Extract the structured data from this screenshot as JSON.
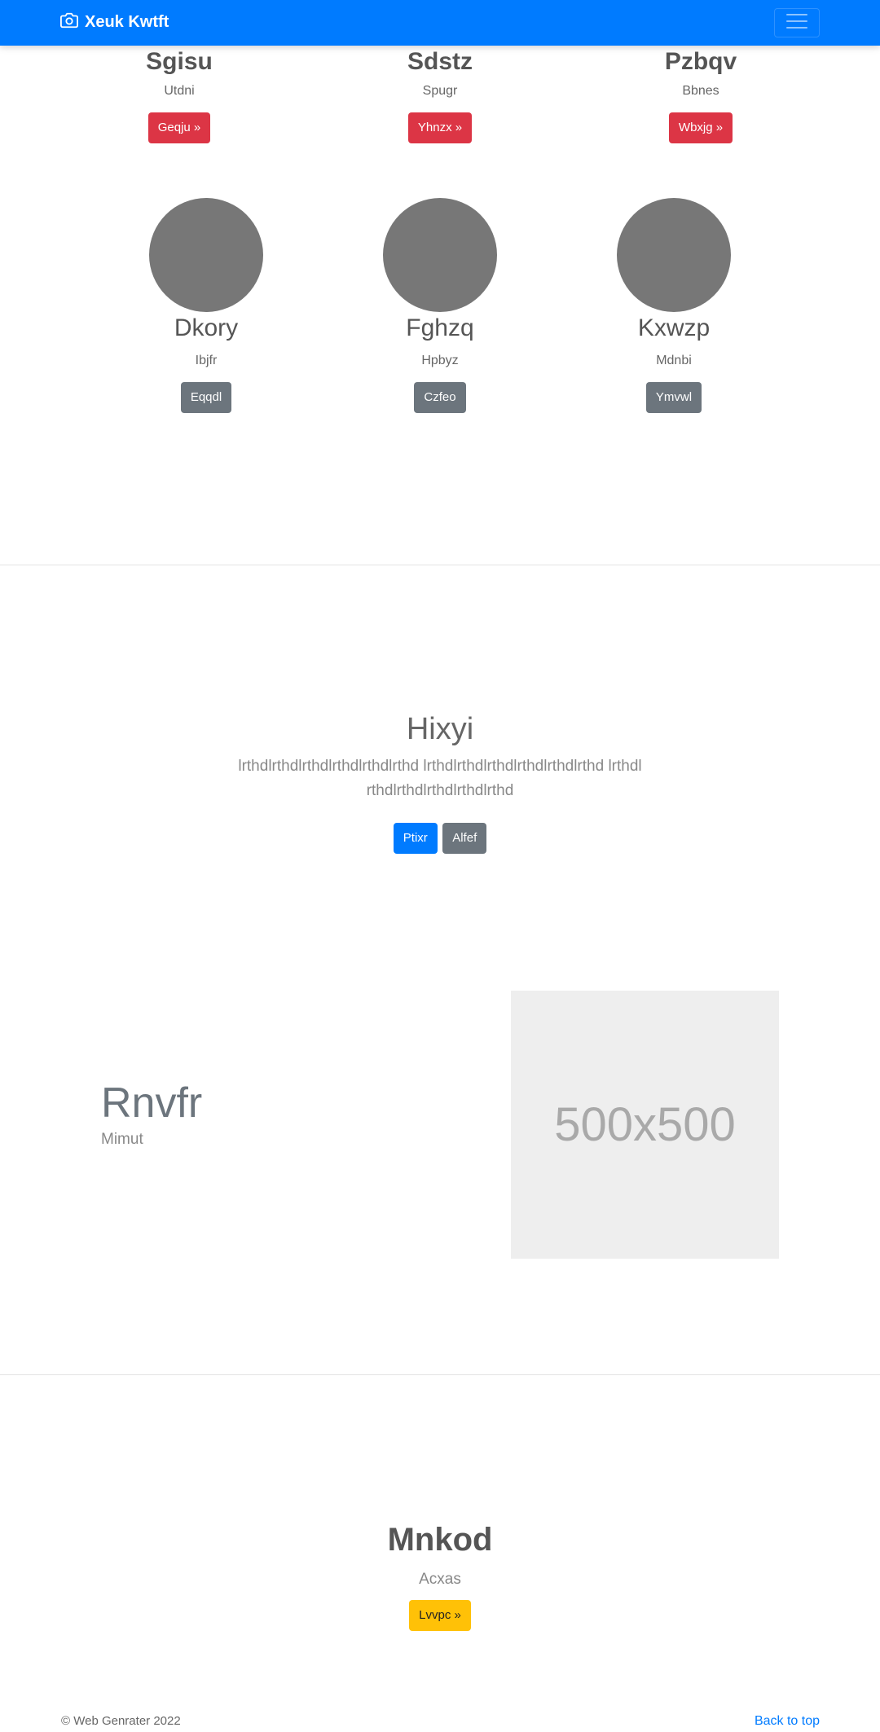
{
  "navbar": {
    "brand": "Xeuk Kwtft",
    "brand_icon": "camera-icon",
    "toggler_icon": "hamburger-menu-icon"
  },
  "top_cards": [
    {
      "title": "Sgisu",
      "text": "Utdni",
      "button": "Geqju »"
    },
    {
      "title": "Sdstz",
      "text": "Spugr",
      "button": "Yhnzx »"
    },
    {
      "title": "Pzbqv",
      "text": "Bbnes",
      "button": "Wbxjg »"
    }
  ],
  "circle_cards": [
    {
      "title": "Dkory",
      "text": "Ibjfr",
      "button": "Eqqdl"
    },
    {
      "title": "Fghzq",
      "text": "Hpbyz",
      "button": "Czfeo"
    },
    {
      "title": "Kxwzp",
      "text": "Mdnbi",
      "button": "Ymvwl"
    }
  ],
  "jumbotron": {
    "title": "Hixyi",
    "text": "lrthdlrthdlrthdlrthdlrthdlrthd lrthdlrthdlrthdlrthdlrthdlrthd lrthdlrthdlrthdlrthdlrthdlrthd",
    "primary_button": "Ptixr",
    "secondary_button": "Alfef"
  },
  "feature": {
    "title": "Rnvfr",
    "text": "Mimut",
    "placeholder_label": "500x500"
  },
  "cta": {
    "title": "Mnkod",
    "text": "Acxas",
    "button": "Lvvpc »"
  },
  "footer": {
    "copyright": "© Web Genrater 2022",
    "back_to_top": "Back to top"
  },
  "colors": {
    "navbar": "#007bff",
    "danger": "#dc3545",
    "secondary": "#6c757d",
    "warning": "#ffc107",
    "circle": "#777777",
    "placeholder": "#eeeeee"
  }
}
